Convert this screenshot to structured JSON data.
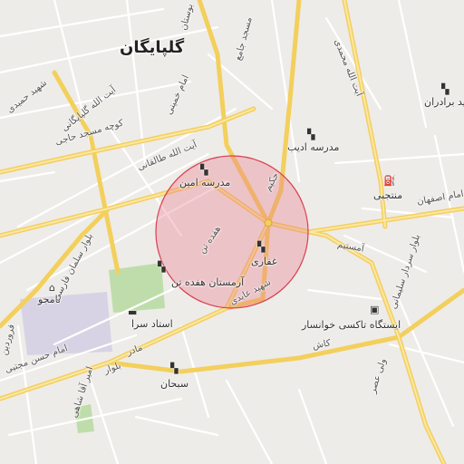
{
  "map": {
    "city": "گلپایگان",
    "colors": {
      "background": "#eeece8",
      "major_road": "#f6d36a",
      "minor_road": "#ffffff",
      "highlight_fill": "#e8788a",
      "highlight_stroke": "#d9404f",
      "green": "#b6dba0",
      "campus": "#d8d3e4"
    },
    "pois": [
      {
        "name": "مدرسه امین",
        "icon": "school-icon"
      },
      {
        "name": "مدرسه ادیب",
        "icon": "school-icon"
      },
      {
        "name": "غفاری",
        "icon": "school-icon"
      },
      {
        "name": "آرمستان هفده تن",
        "icon": "school-icon"
      },
      {
        "name": "منتجبی",
        "icon": "fuel-icon"
      },
      {
        "name": "تامجو",
        "icon": "hospital-icon"
      },
      {
        "name": "استاد سرا",
        "icon": "bed-icon"
      },
      {
        "name": "ایستگاه تاکسی خوانسار",
        "icon": "bus-icon"
      },
      {
        "name": "سبحان",
        "icon": "school-icon"
      },
      {
        "name": "شهید برادران",
        "icon": "school-icon"
      }
    ],
    "roads": [
      "آیت الله محمدی",
      "بوستان",
      "مسجد جامع",
      "آیت الله گلپایگانی",
      "شهید حمیدی",
      "امام خمینی",
      "کوچه مسجد حاجی",
      "آیت الله طالقانی",
      "بلوار سلمان فارسی",
      "هفده تن",
      "شهید عابدی",
      "امام حسن مجتبی",
      "امیر آقا شاهی",
      "بلوار سردار سلیمانی",
      "ولی عصر",
      "آمستیم",
      "امام اصفهان",
      "حکیم",
      "مادر",
      "فروردین",
      "کاش",
      "بلوار"
    ]
  }
}
